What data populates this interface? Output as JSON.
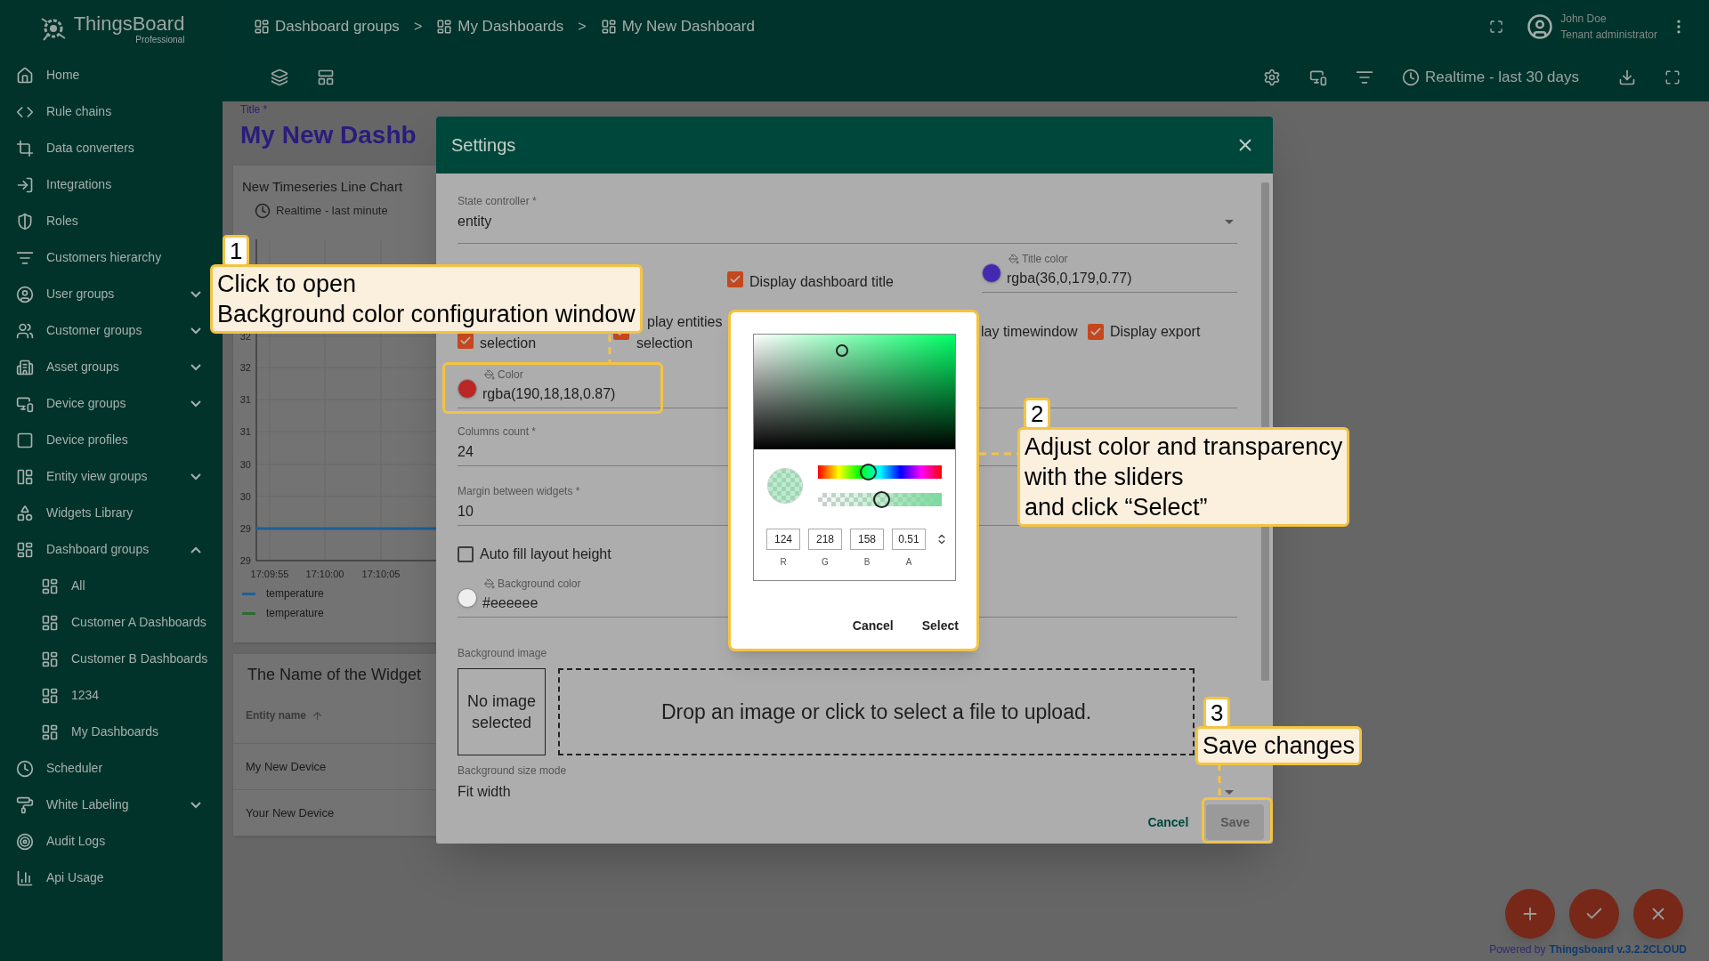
{
  "sidebar": {
    "logo": {
      "name": "ThingsBoard",
      "edition": "Professional"
    },
    "items": [
      {
        "label": "Home"
      },
      {
        "label": "Rule chains"
      },
      {
        "label": "Data converters"
      },
      {
        "label": "Integrations"
      },
      {
        "label": "Roles"
      },
      {
        "label": "Customers hierarchy"
      },
      {
        "label": "User groups",
        "expanded": false
      },
      {
        "label": "Customer groups",
        "expanded": false
      },
      {
        "label": "Asset groups",
        "expanded": false
      },
      {
        "label": "Device groups",
        "expanded": false
      },
      {
        "label": "Device profiles"
      },
      {
        "label": "Entity view groups",
        "expanded": false
      },
      {
        "label": "Widgets Library"
      },
      {
        "label": "Dashboard groups",
        "expanded": true,
        "children": [
          {
            "label": "All"
          },
          {
            "label": "Customer A Dashboards"
          },
          {
            "label": "Customer B Dashboards"
          },
          {
            "label": "1234"
          },
          {
            "label": "My Dashboards"
          }
        ]
      },
      {
        "label": "Scheduler"
      },
      {
        "label": "White Labeling",
        "expanded": false
      },
      {
        "label": "Audit Logs"
      },
      {
        "label": "Api Usage"
      }
    ]
  },
  "header": {
    "breadcrumbs": [
      {
        "label": "Dashboard groups",
        "separator": ">"
      },
      {
        "label": "My Dashboards",
        "separator": ">"
      },
      {
        "label": "My New Dashboard"
      }
    ],
    "user": {
      "name": "John Doe",
      "role": "Tenant administrator"
    },
    "timewindow": "Realtime - last 30 days"
  },
  "dashboard": {
    "title_label": "Title *",
    "title": "My New Dashb",
    "chart_widget": {
      "title": "New Timeseries Line Chart",
      "timewindow": "Realtime - last minute",
      "y_labels": [
        "32",
        "32",
        "31",
        "31",
        "30",
        "30",
        "29",
        "29"
      ],
      "x_labels": [
        "17:09:55",
        "17:10:00",
        "17:10:05"
      ],
      "legend": [
        {
          "label": "temperature",
          "color": "#1d5f98"
        },
        {
          "label": "temperature",
          "color": "#2e6b30"
        }
      ]
    },
    "table_widget": {
      "title": "The Name of the Widget",
      "column": "Entity name",
      "rows": [
        "My New Device",
        "Your New Device"
      ]
    },
    "footer": {
      "prefix": "Powered by",
      "link": "Thingsboard v.3.2.2CLOUD"
    }
  },
  "settings_dialog": {
    "title": "Settings",
    "state_controller": {
      "label": "State controller *",
      "value": "entity"
    },
    "checkboxes": [
      {
        "lines": [
          "selection"
        ],
        "checked": true
      },
      {
        "lines": [
          "play entities",
          "selection"
        ],
        "checked": true
      },
      {
        "lines": [
          "Display dashboard title"
        ],
        "checked": true
      },
      {
        "lines": [
          "lay timewindow"
        ]
      },
      {
        "lines": [
          "Display export"
        ],
        "checked": true
      }
    ],
    "title_color": {
      "label": "Title color",
      "value": "rgba(36,0,179,0.77)"
    },
    "color": {
      "label": "Color",
      "value": "rgba(190,18,18,0.87)"
    },
    "columns_count": {
      "label": "Columns count *",
      "value": "24"
    },
    "margin": {
      "label": "Margin between widgets *",
      "value": "10"
    },
    "auto_fill": {
      "label": "Auto fill layout height",
      "checked": false
    },
    "background_color": {
      "label": "Background color",
      "value": "#eeeeee"
    },
    "background_image": {
      "label": "Background image",
      "preview": "No image selected",
      "dropzone": "Drop an image or click to select a file to upload."
    },
    "background_size_mode": {
      "label": "Background size mode",
      "value": "Fit width"
    },
    "buttons": [
      {
        "label": "Cancel",
        "kind": "text"
      },
      {
        "label": "Save",
        "kind": "raised",
        "disabled": true
      }
    ]
  },
  "color_picker": {
    "hue": {
      "level": 0.4
    },
    "alpha": {
      "level": 0.51
    },
    "channels": [
      {
        "value": "124",
        "label": "R"
      },
      {
        "value": "218",
        "label": "G"
      },
      {
        "value": "158",
        "label": "B"
      },
      {
        "value": "0.51",
        "label": "A"
      }
    ],
    "buttons": [
      "Cancel",
      "Select"
    ]
  },
  "callouts": [
    {
      "number": "1",
      "lines": [
        "Click to open",
        "Background color configuration window"
      ]
    },
    {
      "number": "2",
      "lines": [
        "Adjust color and transparency",
        "with the sliders",
        "and click “Select”"
      ]
    },
    {
      "number": "3",
      "lines": [
        "Save changes"
      ]
    }
  ]
}
